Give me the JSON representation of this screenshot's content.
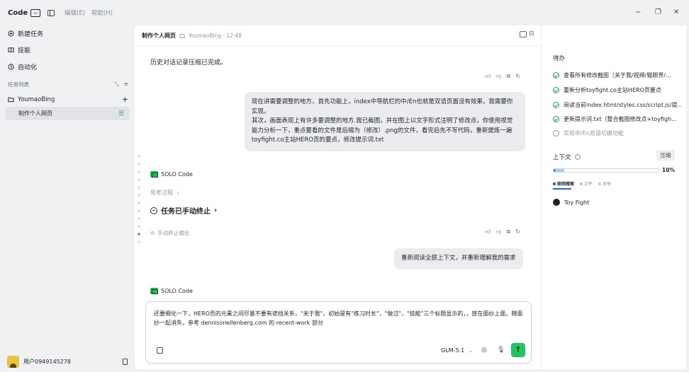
{
  "titlebar": {
    "app_name": "Code",
    "menu": [
      "编辑(E)",
      "帮助(H)"
    ],
    "window_controls": [
      "−",
      "❐",
      "✕"
    ]
  },
  "sidebar": {
    "items": [
      {
        "label": "新建任务",
        "icon": "new-task-icon"
      },
      {
        "label": "技能",
        "icon": "skills-icon"
      },
      {
        "label": "自动化",
        "icon": "clock-icon"
      }
    ],
    "task_list_label": "任务列表",
    "project": "YoumaoBing",
    "active_task": "制作个人网页",
    "user": "用户0949145278"
  },
  "main": {
    "title": "制作个人网页",
    "subtitle": "YoumaoBing · 12:48",
    "history_note": "历史对话记录压缩已完成。",
    "user_message_1": "现在讲需要调整的地方，首先功能上，index中导航栏的中/En也就是双语页面没有效果，我需要你实现。\n其次，画面表现上有许多要调整的地方.我已截图，并在图上以文字形式注明了修改点，你使用视觉能力分析一下，重点要看的文件是后缀为（修改）.png的文件，看完后先不写代码，重新提炼一遍toyfight.co主站HERO页的要点，修改提示词.txt",
    "agent_name": "SOLO Code",
    "thinking_label": "思考过程",
    "stopped_label": "任务已手动终止",
    "stopped_note": "手动终止输出",
    "user_message_2": "重新阅读全部上下文，并重新理解我的需求",
    "composer_text": "还要细化一下，HERO页的元素之间尽量不要有遮挡关系，\"关于我\"，初始是有\"练习时长\"，\"做过\"，\"技能\"三个标题显示的，，放在面纱上面，随面纱一起消失，参考 dennissnellenberg.com 的 recent-work 部分",
    "model": "GLM-5.1"
  },
  "right_panel": {
    "title": "待办",
    "todos": [
      {
        "text": "查看所有修改截图（关于我/视频/猫眼界/...",
        "done": true
      },
      {
        "text": "重新分析toyfight.co主站HERO页要点",
        "done": true
      },
      {
        "text": "阅读当前index.html/styles.css/script.js/提...",
        "done": true
      },
      {
        "text": "更新提示词.txt（整合截图修改点+toyfigh...",
        "done": true
      },
      {
        "text": "实现中/En双语切换功能",
        "done": false
      }
    ],
    "context_title": "上下文",
    "compress_label": "压缩",
    "context_percent": "10%",
    "context_fraction": 0.1,
    "legend": [
      "联网搜索",
      "文件",
      "其他"
    ],
    "legend_colors": [
      "#1f6fd1",
      "#99d4f5",
      "#c9ccd2"
    ],
    "context_entry": "Toy Fight"
  },
  "colors": {
    "accent_green": "#22c55e",
    "bubble_bg": "#ebecef",
    "progress_fill": "#99d4f5"
  }
}
